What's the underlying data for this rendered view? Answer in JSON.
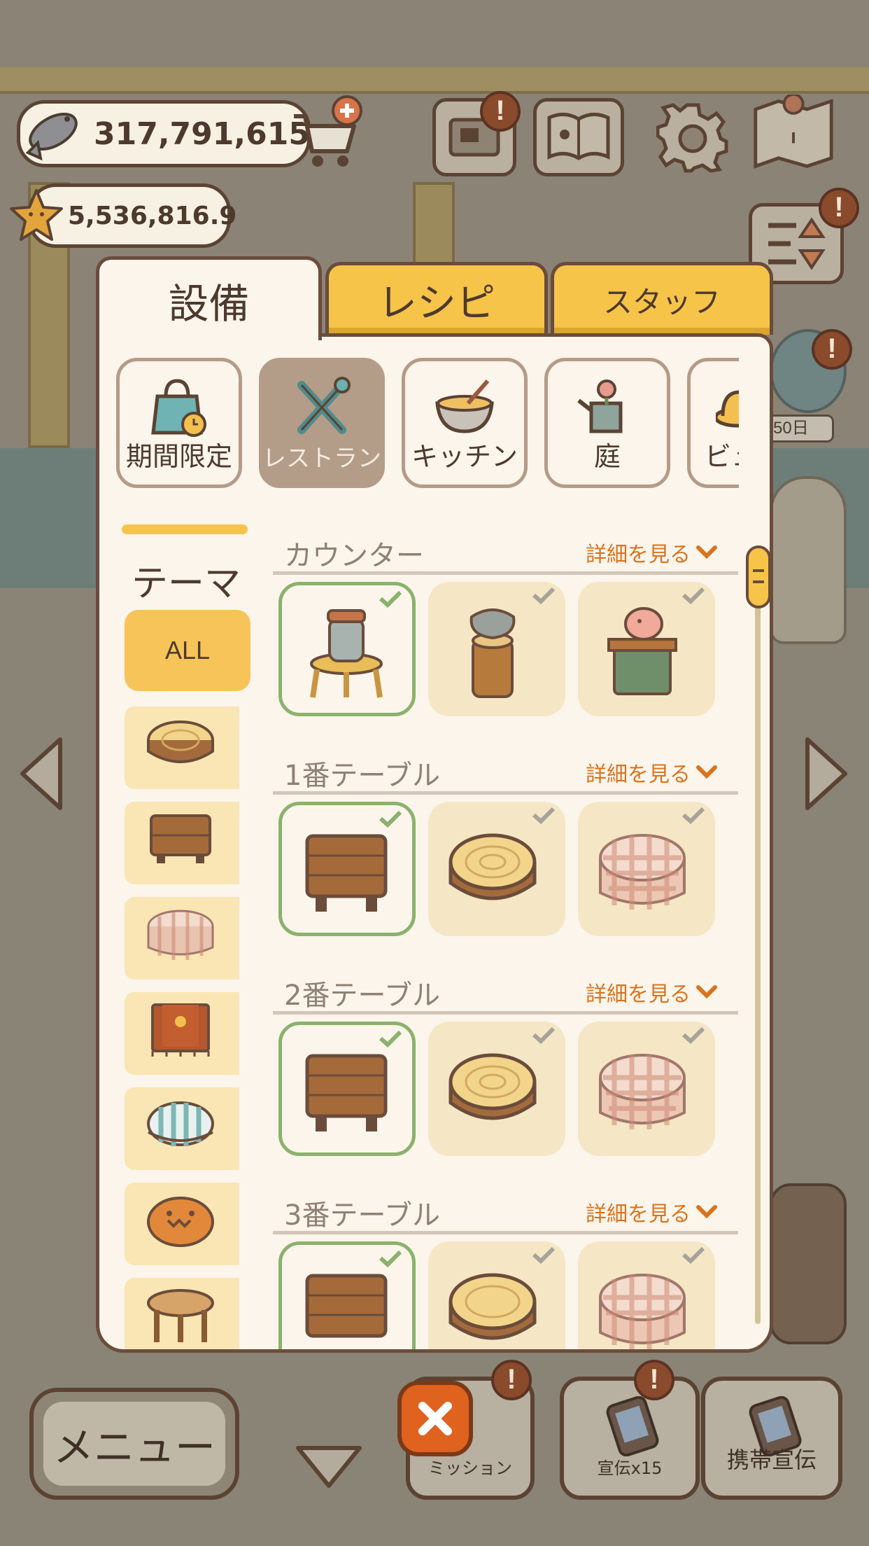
{
  "hud": {
    "fish_currency": "317,791,615",
    "star_currency": "5,536,816.9",
    "alert_mark": "!"
  },
  "scene": {
    "day_label": "50日"
  },
  "tabs": [
    {
      "label": "設備",
      "active": true
    },
    {
      "label": "レシピ",
      "active": false
    },
    {
      "label": "スタッフ",
      "active": false
    }
  ],
  "categories": [
    {
      "label": "期間限定",
      "icon": "limited-bag-icon",
      "active": false
    },
    {
      "label": "レストラン",
      "icon": "restaurant-tools-icon",
      "active": true
    },
    {
      "label": "キッチン",
      "icon": "mixing-bowl-icon",
      "active": false
    },
    {
      "label": "庭",
      "icon": "watering-can-icon",
      "active": false
    },
    {
      "label": "ビュ",
      "icon": "hat-icon",
      "active": false
    }
  ],
  "theme": {
    "title": "テーマ",
    "all_label": "ALL",
    "items": [
      "stump-table-icon",
      "wood-table-icon",
      "gingham-table-icon",
      "paw-rug-table-icon",
      "striped-table-icon",
      "pumpkin-table-icon",
      "round-stool-icon"
    ]
  },
  "sections": [
    {
      "title": "カウンター",
      "detail": "詳細を見る",
      "items": [
        "jar-stool-counter",
        "stump-counter",
        "piggy-bank-counter"
      ]
    },
    {
      "title": "1番テーブル",
      "detail": "詳細を見る",
      "items": [
        "wood-table",
        "stump-table",
        "gingham-table"
      ]
    },
    {
      "title": "2番テーブル",
      "detail": "詳細を見る",
      "items": [
        "wood-table",
        "stump-table",
        "gingham-table"
      ]
    },
    {
      "title": "3番テーブル",
      "detail": "詳細を見る",
      "items": [
        "wood-table",
        "stump-table",
        "gingham-table"
      ]
    }
  ],
  "bottom": {
    "menu_label": "メニュー",
    "mission_label": "ミッション",
    "ad_label": "宣伝x15",
    "mobile_ad_label": "携帯宣伝"
  },
  "colors": {
    "accent_yellow": "#f7c44a",
    "panel_bg": "#fbf5ec",
    "border_brown": "#6b4c3b",
    "owned_green": "#8bb26c",
    "detail_orange": "#d8741e",
    "close_orange": "#e0621f"
  }
}
